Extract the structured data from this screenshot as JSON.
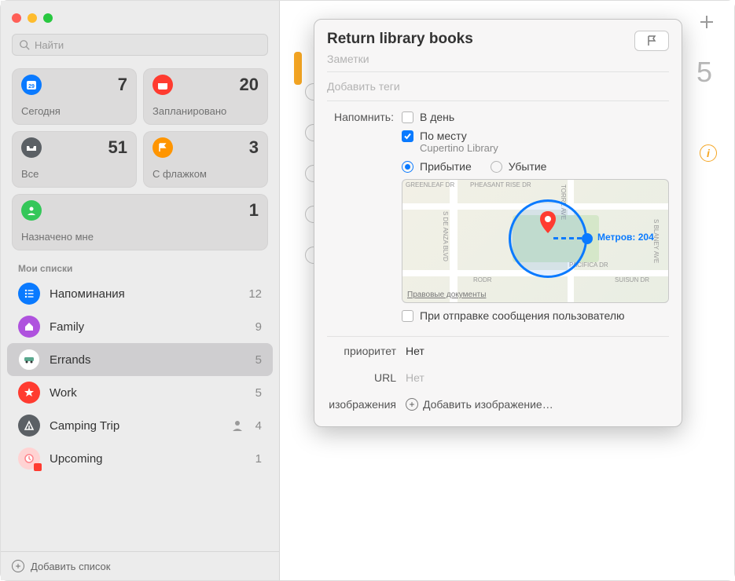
{
  "search": {
    "placeholder": "Найти"
  },
  "cards": [
    {
      "label": "Сегодня",
      "count": "7",
      "color": "#0a7aff"
    },
    {
      "label": "Запланировано",
      "count": "20",
      "color": "#ff3b30"
    },
    {
      "label": "Все",
      "count": "51",
      "color": "#5b6065"
    },
    {
      "label": "С флажком",
      "count": "3",
      "color": "#ff9500"
    },
    {
      "label": "Назначено мне",
      "count": "1",
      "color": "#34c759"
    }
  ],
  "section_title": "Мои списки",
  "lists": [
    {
      "name": "Напоминания",
      "count": "12",
      "color": "#0a7aff",
      "shared": false
    },
    {
      "name": "Family",
      "count": "9",
      "color": "#af52de",
      "shared": false
    },
    {
      "name": "Errands",
      "count": "5",
      "color": "#ffffff",
      "shared": false,
      "selected": true
    },
    {
      "name": "Work",
      "count": "5",
      "color": "#ff3b30",
      "shared": false
    },
    {
      "name": "Camping Trip",
      "count": "4",
      "color": "#5b6065",
      "shared": true
    },
    {
      "name": "Upcoming",
      "count": "1",
      "color": "#ffd3d3",
      "shared": false
    }
  ],
  "footer": {
    "add_list": "Добавить список"
  },
  "main": {
    "big_number": "5"
  },
  "panel": {
    "title": "Return library books",
    "notes_placeholder": "Заметки",
    "tags_placeholder": "Добавить теги",
    "remind_label": "Напомнить:",
    "on_day": "В день",
    "by_location": "По месту",
    "location_name": "Cupertino Library",
    "arriving": "Прибытие",
    "leaving": "Убытие",
    "radius_label": "Метров: 204",
    "legal": "Правовые документы",
    "on_message": "При отправке сообщения пользователю",
    "priority_label": "приоритет",
    "priority_value": "Нет",
    "url_label": "URL",
    "url_value": "Нет",
    "images_label": "изображения",
    "add_image": "Добавить изображение…",
    "streets": {
      "s1": "GREENLEAF DR",
      "s2": "PHEASANT RISE DR",
      "s3": "S DE ANZA BLVD",
      "s4": "TORRE AVE",
      "s5": "S BLANEY AVE",
      "s6": "PACIFICA DR",
      "s7": "SUISUN DR",
      "s8": "RODR"
    }
  }
}
